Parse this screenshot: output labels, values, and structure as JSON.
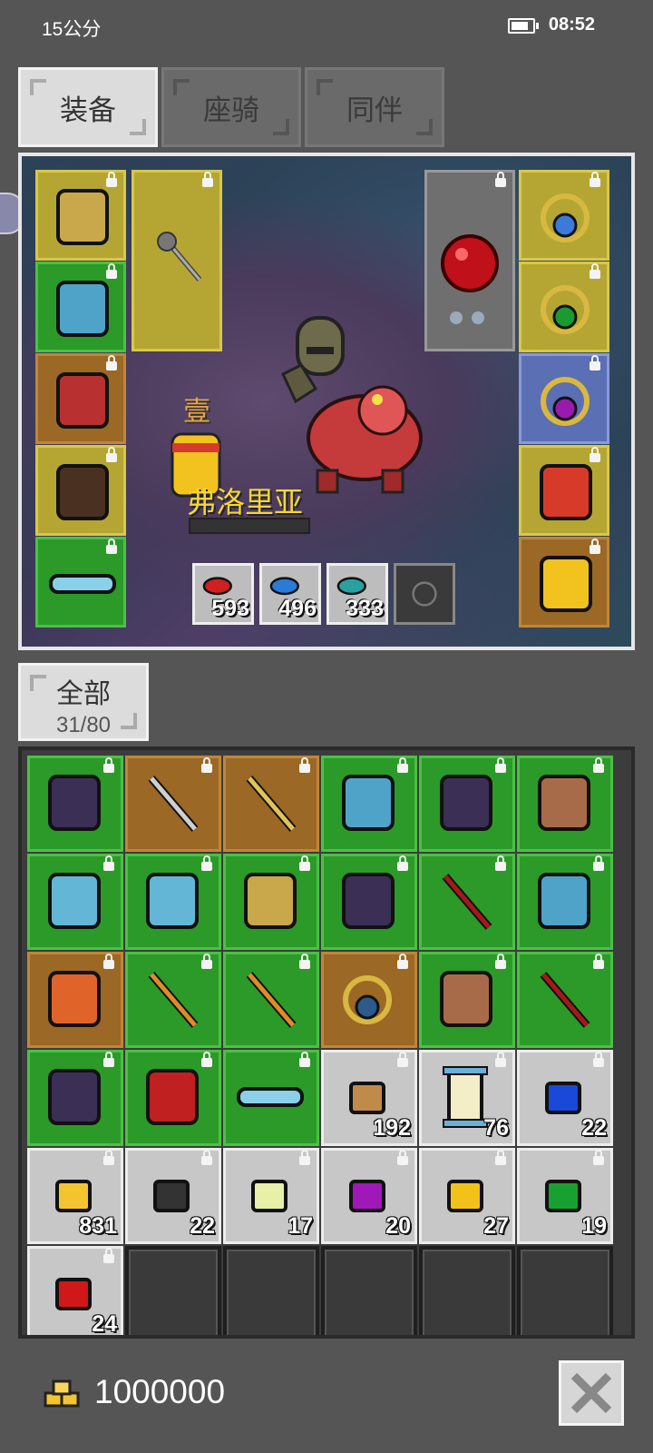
{
  "status_bar": {
    "left_text": "15公分",
    "time": "08:52"
  },
  "tabs": [
    {
      "label": "装备",
      "active": true
    },
    {
      "label": "座骑",
      "active": false
    },
    {
      "label": "同伴",
      "active": false
    }
  ],
  "character": {
    "rank": "壹",
    "name": "弗洛里亚"
  },
  "equipment_left": [
    {
      "icon": "helmet-icon",
      "color": "gold"
    },
    {
      "icon": "chest-armor-icon",
      "color": "green"
    },
    {
      "icon": "gloves-icon",
      "color": "brown"
    },
    {
      "icon": "boots-icon",
      "color": "gold"
    },
    {
      "icon": "belt-icon",
      "color": "green"
    }
  ],
  "weapon_slot": {
    "icon": "mace-icon",
    "color": "gold"
  },
  "offhand_slot": {
    "icon": "ruby-orb-icon",
    "color": "gray"
  },
  "equipment_right": [
    {
      "icon": "amulet-icon",
      "color": "gold"
    },
    {
      "icon": "emerald-ring-icon",
      "color": "gold"
    },
    {
      "icon": "amethyst-ring-icon",
      "color": "blue"
    },
    {
      "icon": "mount-portrait-icon",
      "color": "gold"
    },
    {
      "icon": "companion-portrait-icon",
      "color": "brown"
    }
  ],
  "potions": [
    {
      "icon": "red-potion-icon",
      "count": "593"
    },
    {
      "icon": "blue-potion-icon",
      "count": "496"
    },
    {
      "icon": "teal-potion-icon",
      "count": "333"
    },
    {
      "icon": "empty-potion-slot-icon",
      "count": ""
    }
  ],
  "filter": {
    "label": "全部",
    "count": "31/80"
  },
  "inventory": [
    {
      "icon": "dark-armor-icon",
      "color": "green",
      "qty": ""
    },
    {
      "icon": "sword-icon",
      "color": "brown",
      "qty": ""
    },
    {
      "icon": "spear-icon",
      "color": "brown",
      "qty": ""
    },
    {
      "icon": "chest-armor-icon",
      "color": "green",
      "qty": ""
    },
    {
      "icon": "dark-armor-icon",
      "color": "green",
      "qty": ""
    },
    {
      "icon": "ogre-mask-icon",
      "color": "green",
      "qty": ""
    },
    {
      "icon": "gauntlet-icon",
      "color": "green",
      "qty": ""
    },
    {
      "icon": "gauntlet-icon",
      "color": "green",
      "qty": ""
    },
    {
      "icon": "helmet-icon",
      "color": "green",
      "qty": ""
    },
    {
      "icon": "dark-armor-icon",
      "color": "green",
      "qty": ""
    },
    {
      "icon": "red-sword-icon",
      "color": "green",
      "qty": ""
    },
    {
      "icon": "chest-armor-icon",
      "color": "green",
      "qty": ""
    },
    {
      "icon": "flame-armor-icon",
      "color": "brown",
      "qty": ""
    },
    {
      "icon": "torch-spear-icon",
      "color": "green",
      "qty": ""
    },
    {
      "icon": "torch-spear-icon",
      "color": "green",
      "qty": ""
    },
    {
      "icon": "crystal-orb-icon",
      "color": "brown",
      "qty": ""
    },
    {
      "icon": "ogre-mask-icon",
      "color": "green",
      "qty": ""
    },
    {
      "icon": "red-sword-icon",
      "color": "green",
      "qty": ""
    },
    {
      "icon": "dark-armor-icon",
      "color": "green",
      "qty": ""
    },
    {
      "icon": "red-armor-icon",
      "color": "green",
      "qty": ""
    },
    {
      "icon": "belt-icon",
      "color": "green",
      "qty": ""
    },
    {
      "icon": "ore-icon",
      "color": "gray",
      "qty": "192"
    },
    {
      "icon": "scroll-icon",
      "color": "gray",
      "qty": "76"
    },
    {
      "icon": "blue-gem-icon",
      "color": "gray",
      "qty": "22"
    },
    {
      "icon": "gold-pile-icon",
      "color": "gray",
      "qty": "831"
    },
    {
      "icon": "black-gem-icon",
      "color": "gray",
      "qty": "22"
    },
    {
      "icon": "pale-gem-icon",
      "color": "gray",
      "qty": "17"
    },
    {
      "icon": "purple-gem-icon",
      "color": "gray",
      "qty": "20"
    },
    {
      "icon": "yellow-gem-icon",
      "color": "gray",
      "qty": "27"
    },
    {
      "icon": "green-gem-icon",
      "color": "gray",
      "qty": "19"
    },
    {
      "icon": "red-gem-icon",
      "color": "gray",
      "qty": "24"
    },
    {
      "icon": "empty-slot",
      "color": "empty",
      "qty": ""
    },
    {
      "icon": "empty-slot",
      "color": "empty",
      "qty": ""
    },
    {
      "icon": "empty-slot",
      "color": "empty",
      "qty": ""
    },
    {
      "icon": "empty-slot",
      "color": "empty",
      "qty": ""
    },
    {
      "icon": "empty-slot",
      "color": "empty",
      "qty": ""
    }
  ],
  "currency": {
    "amount": "1000000",
    "icon": "gold-coins-icon"
  },
  "close_button": {
    "icon": "close-icon"
  }
}
